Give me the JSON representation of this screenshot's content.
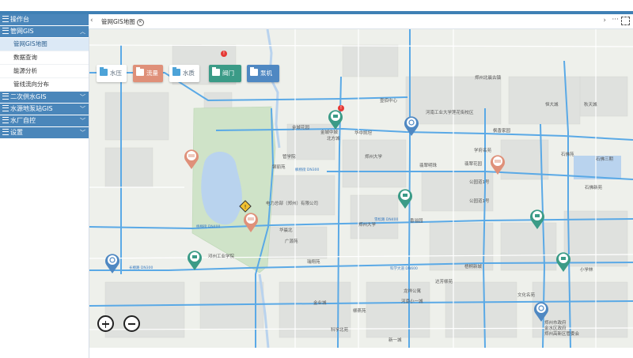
{
  "sidebar": {
    "menus": [
      {
        "label": "操作台",
        "expanded": false
      },
      {
        "label": "管网GIS",
        "expanded": true,
        "chevron": "︿",
        "items": [
          {
            "label": "管网GIS地图",
            "active": true
          },
          {
            "label": "数据查询",
            "active": false
          },
          {
            "label": "能源分析",
            "active": false
          },
          {
            "label": "管线流向分布",
            "active": false
          }
        ]
      },
      {
        "label": "二次供水GIS",
        "expanded": false,
        "chevron": "﹀"
      },
      {
        "label": "水源地泵站GIS",
        "expanded": false,
        "chevron": "﹀"
      },
      {
        "label": "水厂自控",
        "expanded": false,
        "chevron": "﹀"
      },
      {
        "label": "设置",
        "expanded": false,
        "chevron": "﹀"
      }
    ]
  },
  "tabs": {
    "nav_left": "‹",
    "active_tab": "管网GIS地图",
    "close_glyph": "×",
    "nav_right": "›",
    "more": "···"
  },
  "layers": [
    {
      "label": "水压",
      "state": "off"
    },
    {
      "label": "流量",
      "state": "on-red"
    },
    {
      "label": "水质",
      "state": "off"
    },
    {
      "label": "阀门",
      "state": "on-green"
    },
    {
      "label": "泵机",
      "state": "on-blue"
    }
  ],
  "alarm_glyph": "!",
  "colors": {
    "header_blue": "#3f80b5",
    "menu_blue": "#4a86ba",
    "valve_green": "#3b9b87",
    "flow_red": "#df9079",
    "pump_blue": "#4f88c2",
    "road_blue": "#5aa9e6",
    "green_area": "#cfe3c8",
    "water": "#b9d3ee"
  },
  "map_labels": [
    "郑州北晨古镇",
    "河南工业大学莲花街校区",
    "壹佰中心",
    "恒大城",
    "秋天城",
    "金城花园",
    "金城中城",
    "枫香家园",
    "华中凯坦",
    "北方城",
    "郑州大学",
    "管学院",
    "钢丽苑",
    "翡翠明珠",
    "翡翠花园",
    "芭蕉园",
    "学府名苑",
    "公园道1号",
    "公园道1号",
    "石佛苑",
    "石佛三期",
    "石佛新苑",
    "电力总部（郑州）有限公司",
    "华晨北",
    "广源苑",
    "香溢园",
    "郑州大学",
    "梧桐新城",
    "达芳柳苑",
    "瑞翔苑",
    "柳燕苑",
    "龙祥公寓",
    "文化名苑",
    "邓州工业学院",
    "河南小一城",
    "科学北苑",
    "新一城",
    "金业城",
    "小学林",
    "郑州市政府",
    "金水区政府",
    "郑州高新区管委会"
  ],
  "road_labels": [
    "玉兰街 DN400",
    "梧桐街 DN400",
    "枫杨街 DN300",
    "雪松路 DN400",
    "科学大道 DN600",
    "长椿路 DN300"
  ]
}
